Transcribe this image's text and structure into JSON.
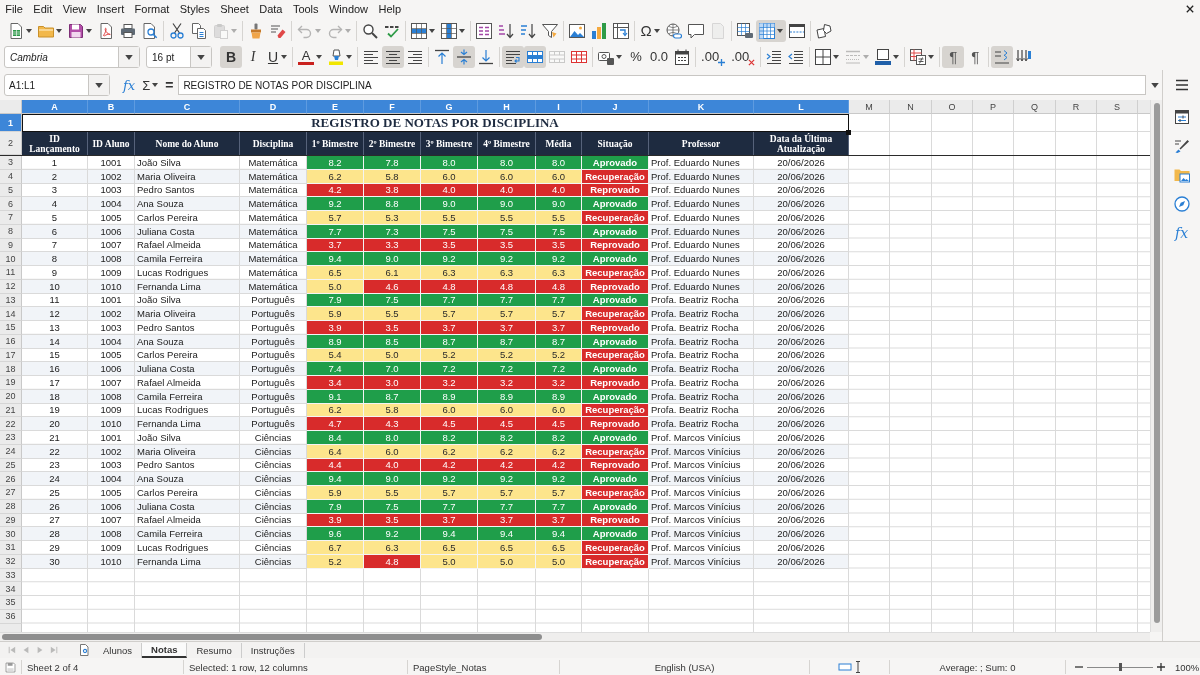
{
  "menu_bar": [
    "File",
    "Edit",
    "View",
    "Insert",
    "Format",
    "Styles",
    "Sheet",
    "Data",
    "Tools",
    "Window",
    "Help"
  ],
  "standard_toolbar": {
    "groups": [
      [
        {
          "kind": "new",
          "on": false,
          "disabled": false
        },
        {
          "kind": "open",
          "on": false,
          "disabled": false
        },
        {
          "kind": "save",
          "on": false,
          "disabled": false
        },
        {
          "kind": "export-pdf",
          "on": false,
          "disabled": false
        },
        {
          "kind": "print",
          "on": false,
          "disabled": false
        },
        {
          "kind": "print-preview",
          "on": false,
          "disabled": false
        }
      ],
      [
        {
          "kind": "cut",
          "on": false,
          "disabled": false
        },
        {
          "kind": "copy",
          "on": false,
          "disabled": false
        },
        {
          "kind": "paste",
          "on": false,
          "disabled": true
        }
      ],
      [
        {
          "kind": "clone-formatting",
          "on": false,
          "disabled": false
        },
        {
          "kind": "clear-formatting",
          "on": false,
          "disabled": false
        }
      ],
      [
        {
          "kind": "undo",
          "on": false,
          "disabled": true
        },
        {
          "kind": "redo",
          "on": false,
          "disabled": true
        }
      ],
      [
        {
          "kind": "find-replace",
          "on": false,
          "disabled": false
        },
        {
          "kind": "spelling",
          "on": false,
          "disabled": false
        }
      ],
      [
        {
          "kind": "row",
          "on": false,
          "disabled": false
        },
        {
          "kind": "column",
          "on": false,
          "disabled": false
        }
      ],
      [
        {
          "kind": "sort",
          "on": false,
          "disabled": false
        },
        {
          "kind": "sort-ascending",
          "on": false,
          "disabled": false
        },
        {
          "kind": "sort-descending",
          "on": false,
          "disabled": false
        },
        {
          "kind": "autofilter",
          "on": false,
          "disabled": false
        }
      ],
      [
        {
          "kind": "image",
          "on": false,
          "disabled": false
        },
        {
          "kind": "chart",
          "on": false,
          "disabled": false
        },
        {
          "kind": "pivot-table",
          "on": false,
          "disabled": false
        }
      ],
      [
        {
          "kind": "special-character",
          "glyph": "Ω",
          "on": false,
          "disabled": false
        },
        {
          "kind": "hyperlink",
          "on": false,
          "disabled": false
        },
        {
          "kind": "comment",
          "on": false,
          "disabled": false
        },
        {
          "kind": "headers-footers",
          "on": false,
          "disabled": true
        }
      ],
      [
        {
          "kind": "print-area",
          "on": false,
          "disabled": false
        },
        {
          "kind": "freeze",
          "on": true,
          "disabled": false
        },
        {
          "kind": "split-window",
          "on": false,
          "disabled": false
        }
      ],
      [
        {
          "kind": "draw-functions",
          "on": false,
          "disabled": false
        }
      ]
    ]
  },
  "formatting_toolbar": {
    "font_name": "Cambria",
    "font_size": "16 pt",
    "groups": [
      [
        {
          "kind": "bold",
          "glyph": "B",
          "on": true,
          "disabled": false
        },
        {
          "kind": "italic",
          "glyph": "I",
          "on": false,
          "disabled": false
        },
        {
          "kind": "underline",
          "glyph": "U",
          "on": false,
          "disabled": false
        }
      ],
      [
        {
          "kind": "font-color",
          "glyph": "A",
          "on": false,
          "disabled": false
        },
        {
          "kind": "highlight",
          "on": false,
          "disabled": false
        }
      ],
      [
        {
          "kind": "align-left",
          "on": false,
          "disabled": false
        },
        {
          "kind": "align-center",
          "on": true,
          "disabled": false
        },
        {
          "kind": "align-right",
          "on": false,
          "disabled": false
        }
      ],
      [
        {
          "kind": "align-top",
          "on": false,
          "disabled": false
        },
        {
          "kind": "align-middle",
          "on": true,
          "disabled": false
        },
        {
          "kind": "align-bottom",
          "on": false,
          "disabled": false
        }
      ],
      [
        {
          "kind": "wrap",
          "on": true,
          "disabled": false
        },
        {
          "kind": "merge-center",
          "on": true,
          "disabled": false
        },
        {
          "kind": "merge",
          "on": false,
          "disabled": true
        },
        {
          "kind": "unmerge",
          "on": false,
          "disabled": false
        }
      ],
      [
        {
          "kind": "currency",
          "on": false,
          "disabled": false
        },
        {
          "kind": "percent",
          "glyph": "%",
          "on": false,
          "disabled": false
        },
        {
          "kind": "number",
          "glyph": "0.0",
          "on": false,
          "disabled": false
        },
        {
          "kind": "date",
          "on": false,
          "disabled": false
        }
      ],
      [
        {
          "kind": "add-decimal",
          "glyph": ".00",
          "on": false,
          "disabled": false
        },
        {
          "kind": "delete-decimal",
          "glyph": ".00",
          "on": false,
          "disabled": false
        }
      ],
      [
        {
          "kind": "indent",
          "on": false,
          "disabled": false
        },
        {
          "kind": "outdent",
          "on": false,
          "disabled": false
        }
      ],
      [
        {
          "kind": "borders",
          "on": false,
          "disabled": false
        },
        {
          "kind": "border-style",
          "on": false,
          "disabled": true
        },
        {
          "kind": "border-color",
          "on": false,
          "disabled": false
        }
      ],
      [
        {
          "kind": "conditional",
          "on": false,
          "disabled": false
        }
      ],
      [
        {
          "kind": "left-to-right",
          "glyph": "¶",
          "on": true,
          "disabled": false
        },
        {
          "kind": "right-to-left",
          "glyph": "¶",
          "on": false,
          "disabled": false
        }
      ],
      [
        {
          "kind": "text-direction-horizontal",
          "on": true,
          "disabled": false
        },
        {
          "kind": "text-direction-vertical",
          "on": false,
          "disabled": false
        }
      ]
    ]
  },
  "formula_bar": {
    "name_box": "A1:L1",
    "function_wizard": "fx",
    "sum": "Σ",
    "formula": "=",
    "content": "REGISTRO DE NOTAS POR DISCIPLINA"
  },
  "sheet": {
    "columns": [
      {
        "letter": "A",
        "selected": true
      },
      {
        "letter": "B",
        "selected": true
      },
      {
        "letter": "C",
        "selected": true
      },
      {
        "letter": "D",
        "selected": true
      },
      {
        "letter": "E",
        "selected": true
      },
      {
        "letter": "F",
        "selected": true
      },
      {
        "letter": "G",
        "selected": true
      },
      {
        "letter": "H",
        "selected": true
      },
      {
        "letter": "I",
        "selected": true
      },
      {
        "letter": "J",
        "selected": true
      },
      {
        "letter": "K",
        "selected": true
      },
      {
        "letter": "L",
        "selected": true
      },
      {
        "letter": "M",
        "selected": false
      },
      {
        "letter": "N",
        "selected": false
      },
      {
        "letter": "O",
        "selected": false
      },
      {
        "letter": "P",
        "selected": false
      },
      {
        "letter": "Q",
        "selected": false
      },
      {
        "letter": "R",
        "selected": false
      },
      {
        "letter": "S",
        "selected": false
      }
    ],
    "row_numbers": [
      {
        "label": "1",
        "selected": true
      },
      {
        "label": "2",
        "selected": false
      },
      {
        "label": "3",
        "selected": false
      },
      {
        "label": "4",
        "selected": false
      },
      {
        "label": "5",
        "selected": false
      },
      {
        "label": "6",
        "selected": false
      },
      {
        "label": "7",
        "selected": false
      },
      {
        "label": "8",
        "selected": false
      },
      {
        "label": "9",
        "selected": false
      },
      {
        "label": "10",
        "selected": false
      },
      {
        "label": "11",
        "selected": false
      },
      {
        "label": "12",
        "selected": false
      },
      {
        "label": "13",
        "selected": false
      },
      {
        "label": "14",
        "selected": false
      },
      {
        "label": "15",
        "selected": false
      },
      {
        "label": "16",
        "selected": false
      },
      {
        "label": "17",
        "selected": false
      },
      {
        "label": "18",
        "selected": false
      },
      {
        "label": "19",
        "selected": false
      },
      {
        "label": "20",
        "selected": false
      },
      {
        "label": "21",
        "selected": false
      },
      {
        "label": "22",
        "selected": false
      },
      {
        "label": "23",
        "selected": false
      },
      {
        "label": "24",
        "selected": false
      },
      {
        "label": "25",
        "selected": false
      },
      {
        "label": "26",
        "selected": false
      },
      {
        "label": "27",
        "selected": false
      },
      {
        "label": "28",
        "selected": false
      },
      {
        "label": "29",
        "selected": false
      },
      {
        "label": "30",
        "selected": false
      },
      {
        "label": "31",
        "selected": false
      },
      {
        "label": "32",
        "selected": false
      },
      {
        "label": "33",
        "selected": false
      },
      {
        "label": "34",
        "selected": false
      },
      {
        "label": "35",
        "selected": false
      },
      {
        "label": "36",
        "selected": false
      }
    ],
    "title": "REGISTRO DE NOTAS POR DISCIPLINA",
    "headers": [
      "ID Lançamento",
      "ID Aluno",
      "Nome do Aluno",
      "Disciplina",
      "1º Bimestre",
      "2º Bimestre",
      "3º Bimestre",
      "4º Bimestre",
      "Média",
      "Situação",
      "Professor",
      "Data da Última Atualização"
    ],
    "rows": [
      {
        "id": "1",
        "student_id": "1001",
        "name": "João Silva",
        "subject": "Matemática",
        "grades": [
          {
            "value": "8.2",
            "color": "#1f9e4a"
          },
          {
            "value": "7.8",
            "color": "#1f9e4a"
          },
          {
            "value": "8.0",
            "color": "#1f9e4a"
          },
          {
            "value": "8.0",
            "color": "#1f9e4a"
          }
        ],
        "average": {
          "value": "8.0",
          "color": "#1f9e4a"
        },
        "status": {
          "text": "Aprovado",
          "color": "#1f9e4a"
        },
        "professor": "Prof. Eduardo Nunes",
        "date": "20/06/2026"
      },
      {
        "id": "2",
        "student_id": "1002",
        "name": "Maria Oliveira",
        "subject": "Matemática",
        "grades": [
          {
            "value": "6.2",
            "color": "#fde58c"
          },
          {
            "value": "5.8",
            "color": "#fde58c"
          },
          {
            "value": "6.0",
            "color": "#fde58c"
          },
          {
            "value": "6.0",
            "color": "#fde58c"
          }
        ],
        "average": {
          "value": "6.0",
          "color": "#fde58c"
        },
        "status": {
          "text": "Recuperação",
          "color": "#d82b2b"
        },
        "professor": "Prof. Eduardo Nunes",
        "date": "20/06/2026"
      },
      {
        "id": "3",
        "student_id": "1003",
        "name": "Pedro Santos",
        "subject": "Matemática",
        "grades": [
          {
            "value": "4.2",
            "color": "#d82b2b"
          },
          {
            "value": "3.8",
            "color": "#d82b2b"
          },
          {
            "value": "4.0",
            "color": "#d82b2b"
          },
          {
            "value": "4.0",
            "color": "#d82b2b"
          }
        ],
        "average": {
          "value": "4.0",
          "color": "#d82b2b"
        },
        "status": {
          "text": "Reprovado",
          "color": "#d82b2b"
        },
        "professor": "Prof. Eduardo Nunes",
        "date": "20/06/2026"
      },
      {
        "id": "4",
        "student_id": "1004",
        "name": "Ana Souza",
        "subject": "Matemática",
        "grades": [
          {
            "value": "9.2",
            "color": "#1f9e4a"
          },
          {
            "value": "8.8",
            "color": "#1f9e4a"
          },
          {
            "value": "9.0",
            "color": "#1f9e4a"
          },
          {
            "value": "9.0",
            "color": "#1f9e4a"
          }
        ],
        "average": {
          "value": "9.0",
          "color": "#1f9e4a"
        },
        "status": {
          "text": "Aprovado",
          "color": "#1f9e4a"
        },
        "professor": "Prof. Eduardo Nunes",
        "date": "20/06/2026"
      },
      {
        "id": "5",
        "student_id": "1005",
        "name": "Carlos Pereira",
        "subject": "Matemática",
        "grades": [
          {
            "value": "5.7",
            "color": "#fde58c"
          },
          {
            "value": "5.3",
            "color": "#fde58c"
          },
          {
            "value": "5.5",
            "color": "#fde58c"
          },
          {
            "value": "5.5",
            "color": "#fde58c"
          }
        ],
        "average": {
          "value": "5.5",
          "color": "#fde58c"
        },
        "status": {
          "text": "Recuperação",
          "color": "#d82b2b"
        },
        "professor": "Prof. Eduardo Nunes",
        "date": "20/06/2026"
      },
      {
        "id": "6",
        "student_id": "1006",
        "name": "Juliana Costa",
        "subject": "Matemática",
        "grades": [
          {
            "value": "7.7",
            "color": "#1f9e4a"
          },
          {
            "value": "7.3",
            "color": "#1f9e4a"
          },
          {
            "value": "7.5",
            "color": "#1f9e4a"
          },
          {
            "value": "7.5",
            "color": "#1f9e4a"
          }
        ],
        "average": {
          "value": "7.5",
          "color": "#1f9e4a"
        },
        "status": {
          "text": "Aprovado",
          "color": "#1f9e4a"
        },
        "professor": "Prof. Eduardo Nunes",
        "date": "20/06/2026"
      },
      {
        "id": "7",
        "student_id": "1007",
        "name": "Rafael Almeida",
        "subject": "Matemática",
        "grades": [
          {
            "value": "3.7",
            "color": "#d82b2b"
          },
          {
            "value": "3.3",
            "color": "#d82b2b"
          },
          {
            "value": "3.5",
            "color": "#d82b2b"
          },
          {
            "value": "3.5",
            "color": "#d82b2b"
          }
        ],
        "average": {
          "value": "3.5",
          "color": "#d82b2b"
        },
        "status": {
          "text": "Reprovado",
          "color": "#d82b2b"
        },
        "professor": "Prof. Eduardo Nunes",
        "date": "20/06/2026"
      },
      {
        "id": "8",
        "student_id": "1008",
        "name": "Camila Ferreira",
        "subject": "Matemática",
        "grades": [
          {
            "value": "9.4",
            "color": "#1f9e4a"
          },
          {
            "value": "9.0",
            "color": "#1f9e4a"
          },
          {
            "value": "9.2",
            "color": "#1f9e4a"
          },
          {
            "value": "9.2",
            "color": "#1f9e4a"
          }
        ],
        "average": {
          "value": "9.2",
          "color": "#1f9e4a"
        },
        "status": {
          "text": "Aprovado",
          "color": "#1f9e4a"
        },
        "professor": "Prof. Eduardo Nunes",
        "date": "20/06/2026"
      },
      {
        "id": "9",
        "student_id": "1009",
        "name": "Lucas Rodrigues",
        "subject": "Matemática",
        "grades": [
          {
            "value": "6.5",
            "color": "#fde58c"
          },
          {
            "value": "6.1",
            "color": "#fde58c"
          },
          {
            "value": "6.3",
            "color": "#fde58c"
          },
          {
            "value": "6.3",
            "color": "#fde58c"
          }
        ],
        "average": {
          "value": "6.3",
          "color": "#fde58c"
        },
        "status": {
          "text": "Recuperação",
          "color": "#d82b2b"
        },
        "professor": "Prof. Eduardo Nunes",
        "date": "20/06/2026"
      },
      {
        "id": "10",
        "student_id": "1010",
        "name": "Fernanda Lima",
        "subject": "Matemática",
        "grades": [
          {
            "value": "5.0",
            "color": "#fde58c"
          },
          {
            "value": "4.6",
            "color": "#d82b2b"
          },
          {
            "value": "4.8",
            "color": "#d82b2b"
          },
          {
            "value": "4.8",
            "color": "#d82b2b"
          }
        ],
        "average": {
          "value": "4.8",
          "color": "#d82b2b"
        },
        "status": {
          "text": "Reprovado",
          "color": "#d82b2b"
        },
        "professor": "Prof. Eduardo Nunes",
        "date": "20/06/2026"
      },
      {
        "id": "11",
        "student_id": "1001",
        "name": "João Silva",
        "subject": "Português",
        "grades": [
          {
            "value": "7.9",
            "color": "#1f9e4a"
          },
          {
            "value": "7.5",
            "color": "#1f9e4a"
          },
          {
            "value": "7.7",
            "color": "#1f9e4a"
          },
          {
            "value": "7.7",
            "color": "#1f9e4a"
          }
        ],
        "average": {
          "value": "7.7",
          "color": "#1f9e4a"
        },
        "status": {
          "text": "Aprovado",
          "color": "#1f9e4a"
        },
        "professor": "Profa. Beatriz Rocha",
        "date": "20/06/2026"
      },
      {
        "id": "12",
        "student_id": "1002",
        "name": "Maria Oliveira",
        "subject": "Português",
        "grades": [
          {
            "value": "5.9",
            "color": "#fde58c"
          },
          {
            "value": "5.5",
            "color": "#fde58c"
          },
          {
            "value": "5.7",
            "color": "#fde58c"
          },
          {
            "value": "5.7",
            "color": "#fde58c"
          }
        ],
        "average": {
          "value": "5.7",
          "color": "#fde58c"
        },
        "status": {
          "text": "Recuperação",
          "color": "#d82b2b"
        },
        "professor": "Profa. Beatriz Rocha",
        "date": "20/06/2026"
      },
      {
        "id": "13",
        "student_id": "1003",
        "name": "Pedro Santos",
        "subject": "Português",
        "grades": [
          {
            "value": "3.9",
            "color": "#d82b2b"
          },
          {
            "value": "3.5",
            "color": "#d82b2b"
          },
          {
            "value": "3.7",
            "color": "#d82b2b"
          },
          {
            "value": "3.7",
            "color": "#d82b2b"
          }
        ],
        "average": {
          "value": "3.7",
          "color": "#d82b2b"
        },
        "status": {
          "text": "Reprovado",
          "color": "#d82b2b"
        },
        "professor": "Profa. Beatriz Rocha",
        "date": "20/06/2026"
      },
      {
        "id": "14",
        "student_id": "1004",
        "name": "Ana Souza",
        "subject": "Português",
        "grades": [
          {
            "value": "8.9",
            "color": "#1f9e4a"
          },
          {
            "value": "8.5",
            "color": "#1f9e4a"
          },
          {
            "value": "8.7",
            "color": "#1f9e4a"
          },
          {
            "value": "8.7",
            "color": "#1f9e4a"
          }
        ],
        "average": {
          "value": "8.7",
          "color": "#1f9e4a"
        },
        "status": {
          "text": "Aprovado",
          "color": "#1f9e4a"
        },
        "professor": "Profa. Beatriz Rocha",
        "date": "20/06/2026"
      },
      {
        "id": "15",
        "student_id": "1005",
        "name": "Carlos Pereira",
        "subject": "Português",
        "grades": [
          {
            "value": "5.4",
            "color": "#fde58c"
          },
          {
            "value": "5.0",
            "color": "#fde58c"
          },
          {
            "value": "5.2",
            "color": "#fde58c"
          },
          {
            "value": "5.2",
            "color": "#fde58c"
          }
        ],
        "average": {
          "value": "5.2",
          "color": "#fde58c"
        },
        "status": {
          "text": "Recuperação",
          "color": "#d82b2b"
        },
        "professor": "Profa. Beatriz Rocha",
        "date": "20/06/2026"
      },
      {
        "id": "16",
        "student_id": "1006",
        "name": "Juliana Costa",
        "subject": "Português",
        "grades": [
          {
            "value": "7.4",
            "color": "#1f9e4a"
          },
          {
            "value": "7.0",
            "color": "#1f9e4a"
          },
          {
            "value": "7.2",
            "color": "#1f9e4a"
          },
          {
            "value": "7.2",
            "color": "#1f9e4a"
          }
        ],
        "average": {
          "value": "7.2",
          "color": "#1f9e4a"
        },
        "status": {
          "text": "Aprovado",
          "color": "#1f9e4a"
        },
        "professor": "Profa. Beatriz Rocha",
        "date": "20/06/2026"
      },
      {
        "id": "17",
        "student_id": "1007",
        "name": "Rafael Almeida",
        "subject": "Português",
        "grades": [
          {
            "value": "3.4",
            "color": "#d82b2b"
          },
          {
            "value": "3.0",
            "color": "#d82b2b"
          },
          {
            "value": "3.2",
            "color": "#d82b2b"
          },
          {
            "value": "3.2",
            "color": "#d82b2b"
          }
        ],
        "average": {
          "value": "3.2",
          "color": "#d82b2b"
        },
        "status": {
          "text": "Reprovado",
          "color": "#d82b2b"
        },
        "professor": "Profa. Beatriz Rocha",
        "date": "20/06/2026"
      },
      {
        "id": "18",
        "student_id": "1008",
        "name": "Camila Ferreira",
        "subject": "Português",
        "grades": [
          {
            "value": "9.1",
            "color": "#1f9e4a"
          },
          {
            "value": "8.7",
            "color": "#1f9e4a"
          },
          {
            "value": "8.9",
            "color": "#1f9e4a"
          },
          {
            "value": "8.9",
            "color": "#1f9e4a"
          }
        ],
        "average": {
          "value": "8.9",
          "color": "#1f9e4a"
        },
        "status": {
          "text": "Aprovado",
          "color": "#1f9e4a"
        },
        "professor": "Profa. Beatriz Rocha",
        "date": "20/06/2026"
      },
      {
        "id": "19",
        "student_id": "1009",
        "name": "Lucas Rodrigues",
        "subject": "Português",
        "grades": [
          {
            "value": "6.2",
            "color": "#fde58c"
          },
          {
            "value": "5.8",
            "color": "#fde58c"
          },
          {
            "value": "6.0",
            "color": "#fde58c"
          },
          {
            "value": "6.0",
            "color": "#fde58c"
          }
        ],
        "average": {
          "value": "6.0",
          "color": "#fde58c"
        },
        "status": {
          "text": "Recuperação",
          "color": "#d82b2b"
        },
        "professor": "Profa. Beatriz Rocha",
        "date": "20/06/2026"
      },
      {
        "id": "20",
        "student_id": "1010",
        "name": "Fernanda Lima",
        "subject": "Português",
        "grades": [
          {
            "value": "4.7",
            "color": "#d82b2b"
          },
          {
            "value": "4.3",
            "color": "#d82b2b"
          },
          {
            "value": "4.5",
            "color": "#d82b2b"
          },
          {
            "value": "4.5",
            "color": "#d82b2b"
          }
        ],
        "average": {
          "value": "4.5",
          "color": "#d82b2b"
        },
        "status": {
          "text": "Reprovado",
          "color": "#d82b2b"
        },
        "professor": "Profa. Beatriz Rocha",
        "date": "20/06/2026"
      },
      {
        "id": "21",
        "student_id": "1001",
        "name": "João Silva",
        "subject": "Ciências",
        "grades": [
          {
            "value": "8.4",
            "color": "#1f9e4a"
          },
          {
            "value": "8.0",
            "color": "#1f9e4a"
          },
          {
            "value": "8.2",
            "color": "#1f9e4a"
          },
          {
            "value": "8.2",
            "color": "#1f9e4a"
          }
        ],
        "average": {
          "value": "8.2",
          "color": "#1f9e4a"
        },
        "status": {
          "text": "Aprovado",
          "color": "#1f9e4a"
        },
        "professor": "Prof. Marcos Vinícius",
        "date": "20/06/2026"
      },
      {
        "id": "22",
        "student_id": "1002",
        "name": "Maria Oliveira",
        "subject": "Ciências",
        "grades": [
          {
            "value": "6.4",
            "color": "#fde58c"
          },
          {
            "value": "6.0",
            "color": "#fde58c"
          },
          {
            "value": "6.2",
            "color": "#fde58c"
          },
          {
            "value": "6.2",
            "color": "#fde58c"
          }
        ],
        "average": {
          "value": "6.2",
          "color": "#fde58c"
        },
        "status": {
          "text": "Recuperação",
          "color": "#d82b2b"
        },
        "professor": "Prof. Marcos Vinícius",
        "date": "20/06/2026"
      },
      {
        "id": "23",
        "student_id": "1003",
        "name": "Pedro Santos",
        "subject": "Ciências",
        "grades": [
          {
            "value": "4.4",
            "color": "#d82b2b"
          },
          {
            "value": "4.0",
            "color": "#d82b2b"
          },
          {
            "value": "4.2",
            "color": "#d82b2b"
          },
          {
            "value": "4.2",
            "color": "#d82b2b"
          }
        ],
        "average": {
          "value": "4.2",
          "color": "#d82b2b"
        },
        "status": {
          "text": "Reprovado",
          "color": "#d82b2b"
        },
        "professor": "Prof. Marcos Vinícius",
        "date": "20/06/2026"
      },
      {
        "id": "24",
        "student_id": "1004",
        "name": "Ana Souza",
        "subject": "Ciências",
        "grades": [
          {
            "value": "9.4",
            "color": "#1f9e4a"
          },
          {
            "value": "9.0",
            "color": "#1f9e4a"
          },
          {
            "value": "9.2",
            "color": "#1f9e4a"
          },
          {
            "value": "9.2",
            "color": "#1f9e4a"
          }
        ],
        "average": {
          "value": "9.2",
          "color": "#1f9e4a"
        },
        "status": {
          "text": "Aprovado",
          "color": "#1f9e4a"
        },
        "professor": "Prof. Marcos Vinícius",
        "date": "20/06/2026"
      },
      {
        "id": "25",
        "student_id": "1005",
        "name": "Carlos Pereira",
        "subject": "Ciências",
        "grades": [
          {
            "value": "5.9",
            "color": "#fde58c"
          },
          {
            "value": "5.5",
            "color": "#fde58c"
          },
          {
            "value": "5.7",
            "color": "#fde58c"
          },
          {
            "value": "5.7",
            "color": "#fde58c"
          }
        ],
        "average": {
          "value": "5.7",
          "color": "#fde58c"
        },
        "status": {
          "text": "Recuperação",
          "color": "#d82b2b"
        },
        "professor": "Prof. Marcos Vinícius",
        "date": "20/06/2026"
      },
      {
        "id": "26",
        "student_id": "1006",
        "name": "Juliana Costa",
        "subject": "Ciências",
        "grades": [
          {
            "value": "7.9",
            "color": "#1f9e4a"
          },
          {
            "value": "7.5",
            "color": "#1f9e4a"
          },
          {
            "value": "7.7",
            "color": "#1f9e4a"
          },
          {
            "value": "7.7",
            "color": "#1f9e4a"
          }
        ],
        "average": {
          "value": "7.7",
          "color": "#1f9e4a"
        },
        "status": {
          "text": "Aprovado",
          "color": "#1f9e4a"
        },
        "professor": "Prof. Marcos Vinícius",
        "date": "20/06/2026"
      },
      {
        "id": "27",
        "student_id": "1007",
        "name": "Rafael Almeida",
        "subject": "Ciências",
        "grades": [
          {
            "value": "3.9",
            "color": "#d82b2b"
          },
          {
            "value": "3.5",
            "color": "#d82b2b"
          },
          {
            "value": "3.7",
            "color": "#d82b2b"
          },
          {
            "value": "3.7",
            "color": "#d82b2b"
          }
        ],
        "average": {
          "value": "3.7",
          "color": "#d82b2b"
        },
        "status": {
          "text": "Reprovado",
          "color": "#d82b2b"
        },
        "professor": "Prof. Marcos Vinícius",
        "date": "20/06/2026"
      },
      {
        "id": "28",
        "student_id": "1008",
        "name": "Camila Ferreira",
        "subject": "Ciências",
        "grades": [
          {
            "value": "9.6",
            "color": "#1f9e4a"
          },
          {
            "value": "9.2",
            "color": "#1f9e4a"
          },
          {
            "value": "9.4",
            "color": "#1f9e4a"
          },
          {
            "value": "9.4",
            "color": "#1f9e4a"
          }
        ],
        "average": {
          "value": "9.4",
          "color": "#1f9e4a"
        },
        "status": {
          "text": "Aprovado",
          "color": "#1f9e4a"
        },
        "professor": "Prof. Marcos Vinícius",
        "date": "20/06/2026"
      },
      {
        "id": "29",
        "student_id": "1009",
        "name": "Lucas Rodrigues",
        "subject": "Ciências",
        "grades": [
          {
            "value": "6.7",
            "color": "#fde58c"
          },
          {
            "value": "6.3",
            "color": "#fde58c"
          },
          {
            "value": "6.5",
            "color": "#fde58c"
          },
          {
            "value": "6.5",
            "color": "#fde58c"
          }
        ],
        "average": {
          "value": "6.5",
          "color": "#fde58c"
        },
        "status": {
          "text": "Recuperação",
          "color": "#d82b2b"
        },
        "professor": "Prof. Marcos Vinícius",
        "date": "20/06/2026"
      },
      {
        "id": "30",
        "student_id": "1010",
        "name": "Fernanda Lima",
        "subject": "Ciências",
        "grades": [
          {
            "value": "5.2",
            "color": "#fde58c"
          },
          {
            "value": "4.8",
            "color": "#d82b2b"
          },
          {
            "value": "5.0",
            "color": "#fde58c"
          },
          {
            "value": "5.0",
            "color": "#fde58c"
          }
        ],
        "average": {
          "value": "5.0",
          "color": "#fde58c"
        },
        "status": {
          "text": "Recuperação",
          "color": "#d82b2b"
        },
        "professor": "Prof. Marcos Vinícius",
        "date": "20/06/2026"
      }
    ]
  },
  "sheet_navigation": [
    {
      "kind": "first",
      "disabled": true
    },
    {
      "kind": "previous",
      "disabled": true
    },
    {
      "kind": "next",
      "disabled": true
    },
    {
      "kind": "last",
      "disabled": true
    }
  ],
  "sheet_tabs": [
    {
      "label": "Alunos",
      "selected": false
    },
    {
      "label": "Notas",
      "selected": true
    },
    {
      "label": "Resumo",
      "selected": false
    },
    {
      "label": "Instruções",
      "selected": false
    }
  ],
  "status_bar": {
    "sheet": "Sheet 2 of 4",
    "selection": "Selected: 1 row, 12 columns",
    "page_style": "PageStyle_Notas",
    "language": "English (USA)",
    "summary": "Average: ; Sum: 0",
    "zoom": {
      "level": 0.5,
      "value": "100%"
    }
  },
  "sidebar": [
    {
      "kind": "properties",
      "selected": false
    },
    {
      "kind": "styles",
      "selected": false
    },
    {
      "kind": "gallery",
      "selected": false
    },
    {
      "kind": "navigator",
      "selected": false
    },
    {
      "kind": "functions",
      "glyph": "fx",
      "selected": false
    }
  ]
}
